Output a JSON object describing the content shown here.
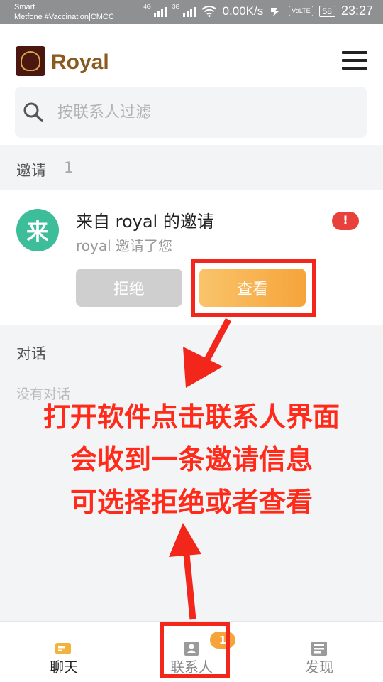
{
  "status_bar": {
    "carrier_line1": "Smart",
    "carrier_line2": "Metfone #Vaccination|CMCC",
    "net1": "4G",
    "net2": "3G",
    "speed": "0.00K/s",
    "volte": "VoLTE",
    "battery": "58",
    "time": "23:27"
  },
  "header": {
    "title": "Royal",
    "search_placeholder": "按联系人过滤"
  },
  "invites": {
    "label": "邀请",
    "count": "1",
    "item": {
      "avatar_char": "来",
      "title": "来自 royal 的邀请",
      "subtitle": "royal 邀请了您",
      "alert": "!",
      "reject_label": "拒绝",
      "view_label": "查看"
    }
  },
  "conversations": {
    "label": "对话",
    "empty_text": "没有对话"
  },
  "annotation": {
    "line1": "打开软件点击联系人界面",
    "line2": "会收到一条邀请信息",
    "line3": "可选择拒绝或者查看"
  },
  "tabbar": {
    "tabs": [
      {
        "label": "聊天",
        "icon": "chat-icon"
      },
      {
        "label": "联系人",
        "icon": "contacts-icon",
        "badge": "1"
      },
      {
        "label": "发现",
        "icon": "discover-icon"
      }
    ]
  },
  "colors": {
    "accent": "#f6a43a",
    "title_brown": "#8a5a1e",
    "avatar_green": "#3dbd9a",
    "alert_red": "#e8403b",
    "annotation_red": "#ff2a1a"
  }
}
